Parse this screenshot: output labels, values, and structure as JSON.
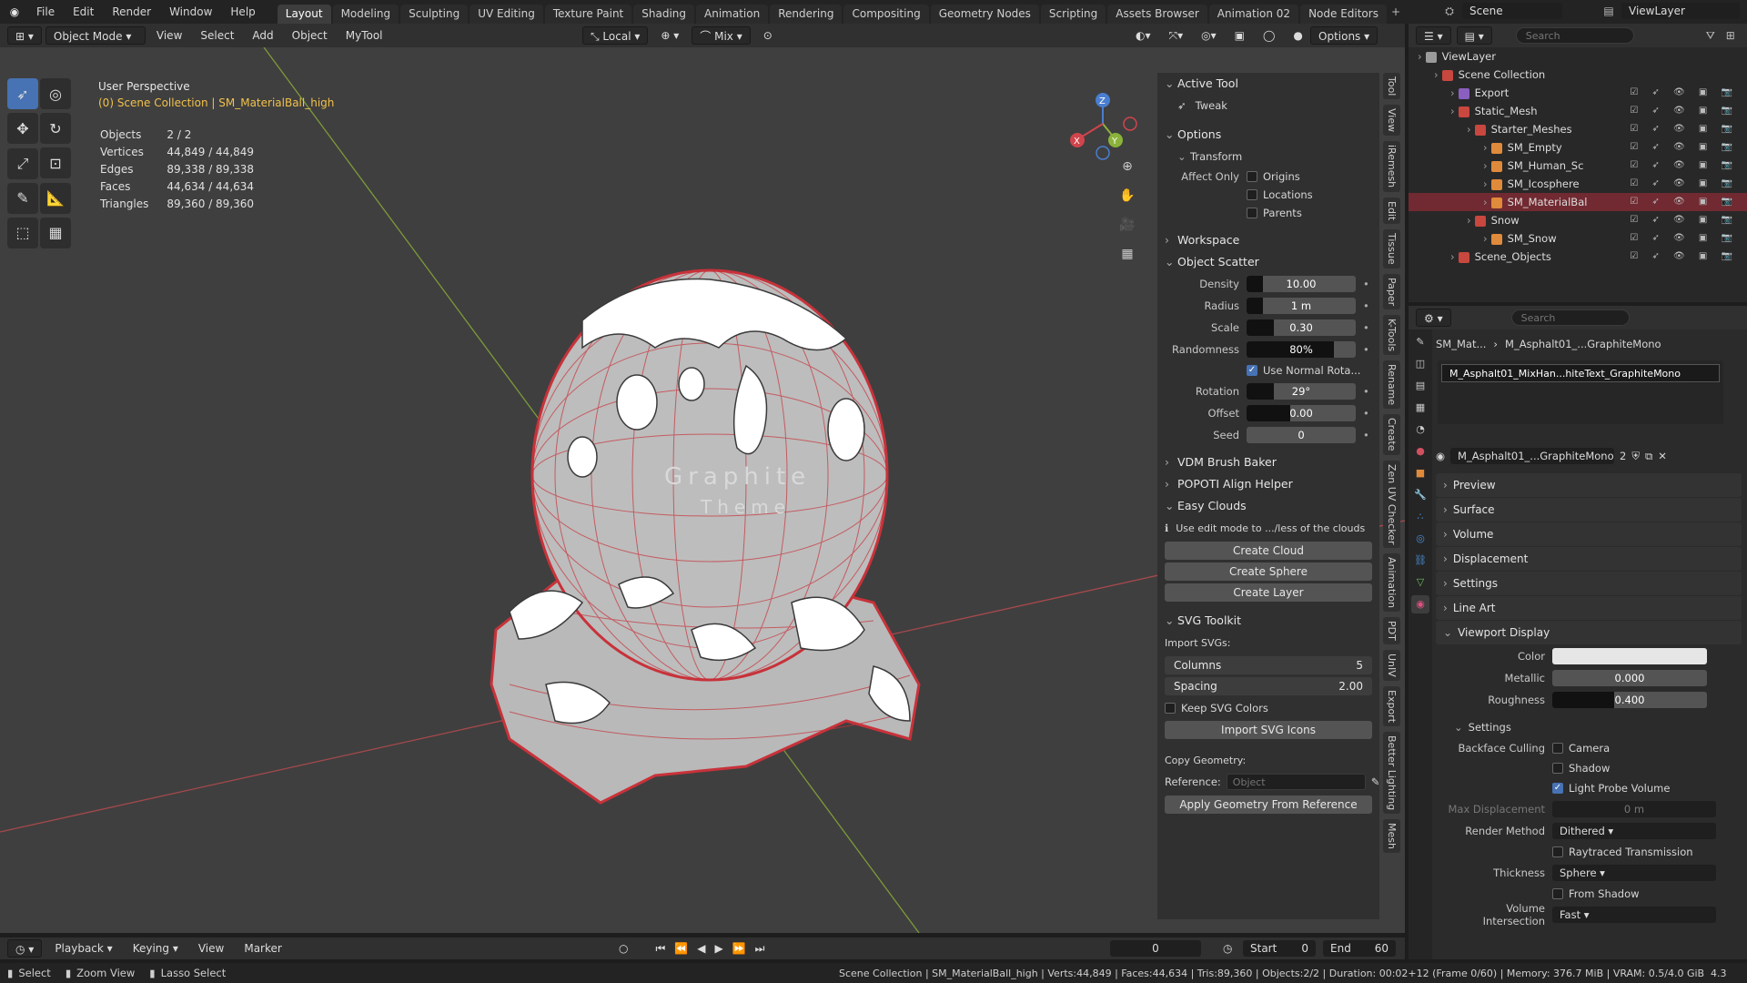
{
  "topbar": {
    "menus": [
      "File",
      "Edit",
      "Render",
      "Window",
      "Help"
    ],
    "workspaces": [
      "Layout",
      "Modeling",
      "Sculpting",
      "UV Editing",
      "Texture Paint",
      "Shading",
      "Animation",
      "Rendering",
      "Compositing",
      "Geometry Nodes",
      "Scripting",
      "Assets Browser",
      "Animation 02",
      "Node Editors"
    ],
    "active_workspace": "Layout",
    "scene": "Scene",
    "view_layer": "ViewLayer"
  },
  "viewport_header": {
    "mode": "Object Mode",
    "menus": [
      "View",
      "Select",
      "Add",
      "Object",
      "MyTool"
    ],
    "transform_orientation": "Local",
    "snap": "Mix",
    "options": "Options"
  },
  "viewport": {
    "perspective": "User Perspective",
    "collection_line": "(0) Scene Collection | SM_MaterialBall_high",
    "stats": [
      {
        "label": "Objects",
        "value": "2 / 2"
      },
      {
        "label": "Vertices",
        "value": "44,849 / 44,849"
      },
      {
        "label": "Edges",
        "value": "89,338 / 89,338"
      },
      {
        "label": "Faces",
        "value": "44,634 / 44,634"
      },
      {
        "label": "Triangles",
        "value": "89,360 / 89,360"
      }
    ],
    "text_on_ball": [
      "Graphite",
      "Theme"
    ]
  },
  "npanel": {
    "active_tool": {
      "title": "Active Tool",
      "tool": "Tweak"
    },
    "options": {
      "title": "Options",
      "transform": "Transform",
      "affect_only": "Affect Only",
      "items": [
        "Origins",
        "Locations",
        "Parents"
      ]
    },
    "workspace": "Workspace",
    "object_scatter": {
      "title": "Object Scatter",
      "rows": [
        {
          "label": "Density",
          "value": "10.00"
        },
        {
          "label": "Radius",
          "value": "1 m"
        },
        {
          "label": "Scale",
          "value": "0.30"
        },
        {
          "label": "Randomness",
          "value": "80%"
        }
      ],
      "use_normal": "Use Normal Rota...",
      "rows2": [
        {
          "label": "Rotation",
          "value": "29°"
        },
        {
          "label": "Offset",
          "value": "0.00"
        },
        {
          "label": "Seed",
          "value": "0"
        }
      ]
    },
    "vdm": "VDM Brush Baker",
    "popoti": "POPOTI Align Helper",
    "easy_clouds": {
      "title": "Easy Clouds",
      "hint": "Use edit mode to .../less of the clouds",
      "buttons": [
        "Create Cloud",
        "Create Sphere",
        "Create Layer"
      ]
    },
    "svg_toolkit": {
      "title": "SVG Toolkit",
      "import_label": "Import SVGs:",
      "columns_label": "Columns",
      "columns_value": "5",
      "spacing_label": "Spacing",
      "spacing_value": "2.00",
      "keep_colors": "Keep SVG Colors",
      "import_btn": "Import SVG Icons",
      "copy_geo": "Copy Geometry:",
      "reference_label": "Reference:",
      "reference_placeholder": "Object",
      "apply_btn": "Apply Geometry From Reference"
    }
  },
  "side_tabs": [
    "Tool",
    "View",
    "iRemesh",
    "Edit",
    "Tissue",
    "Paper",
    "K-Tools",
    "Rename",
    "Create",
    "Zen UV Checker",
    "Animation",
    "PDT",
    "UnIV",
    "Export",
    "Better Lighting",
    "Mesh"
  ],
  "outliner": {
    "search_placeholder": "Search",
    "rows": [
      {
        "name": "ViewLayer",
        "indent": 0,
        "color": "#9a9a9a"
      },
      {
        "name": "Scene Collection",
        "indent": 1,
        "color": "#c8473f"
      },
      {
        "name": "Export",
        "indent": 2,
        "color": "#8a5fbf"
      },
      {
        "name": "Static_Mesh",
        "indent": 2,
        "color": "#c8473f"
      },
      {
        "name": "Starter_Meshes",
        "indent": 3,
        "color": "#c8473f"
      },
      {
        "name": "SM_Empty",
        "indent": 4,
        "color": "#e08a3b"
      },
      {
        "name": "SM_Human_Sc",
        "indent": 4,
        "color": "#e08a3b"
      },
      {
        "name": "SM_Icosphere",
        "indent": 4,
        "color": "#e08a3b"
      },
      {
        "name": "SM_MaterialBal",
        "indent": 4,
        "color": "#e08a3b",
        "selected": true
      },
      {
        "name": "Snow",
        "indent": 3,
        "color": "#c8473f"
      },
      {
        "name": "SM_Snow",
        "indent": 4,
        "color": "#e08a3b"
      },
      {
        "name": "Scene_Objects",
        "indent": 2,
        "color": "#c8473f"
      }
    ]
  },
  "properties": {
    "search_placeholder": "Search",
    "breadcrumb_obj": "SM_Mat...",
    "breadcrumb_mat": "M_Asphalt01_...GraphiteMono",
    "slot_name": "M_Asphalt01_MixHan...hiteText_GraphiteMono",
    "material_name": "M_Asphalt01_...GraphiteMono",
    "users": "2",
    "sections": [
      "Preview",
      "Surface",
      "Volume",
      "Displacement",
      "Settings",
      "Line Art"
    ],
    "viewport_display": {
      "title": "Viewport Display",
      "color_label": "Color",
      "metallic_label": "Metallic",
      "metallic_value": "0.000",
      "roughness_label": "Roughness",
      "roughness_value": "0.400"
    },
    "settings": {
      "title": "Settings",
      "backface_label": "Backface Culling",
      "camera": "Camera",
      "shadow": "Shadow",
      "light_probe": "Light Probe Volume",
      "max_disp_label": "Max Displacement",
      "max_disp_value": "0 m",
      "render_method_label": "Render Method",
      "render_method_value": "Dithered",
      "raytraced": "Raytraced Transmission",
      "thickness_label": "Thickness",
      "thickness_value": "Sphere",
      "from_shadow": "From Shadow",
      "vol_int_label": "Volume Intersection",
      "vol_int_value": "Fast"
    }
  },
  "timeline": {
    "menus": [
      "Playback",
      "Keying",
      "View",
      "Marker"
    ],
    "current_frame": "0",
    "start_label": "Start",
    "start": "0",
    "end_label": "End",
    "end": "60"
  },
  "statusbar": {
    "left": [
      "Select",
      "Zoom View",
      "Lasso Select"
    ],
    "right": "Scene Collection | SM_MaterialBall_high | Verts:44,849 | Faces:44,634 | Tris:89,360 | Objects:2/2 | Duration: 00:02+12 (Frame 0/60) | Memory: 376.7 MiB | VRAM: 0.5/4.0 GiB",
    "version": "4.3"
  },
  "colors": {
    "accent": "#4772b3",
    "selected_row": "#712a31",
    "wire": "#c8323a"
  }
}
